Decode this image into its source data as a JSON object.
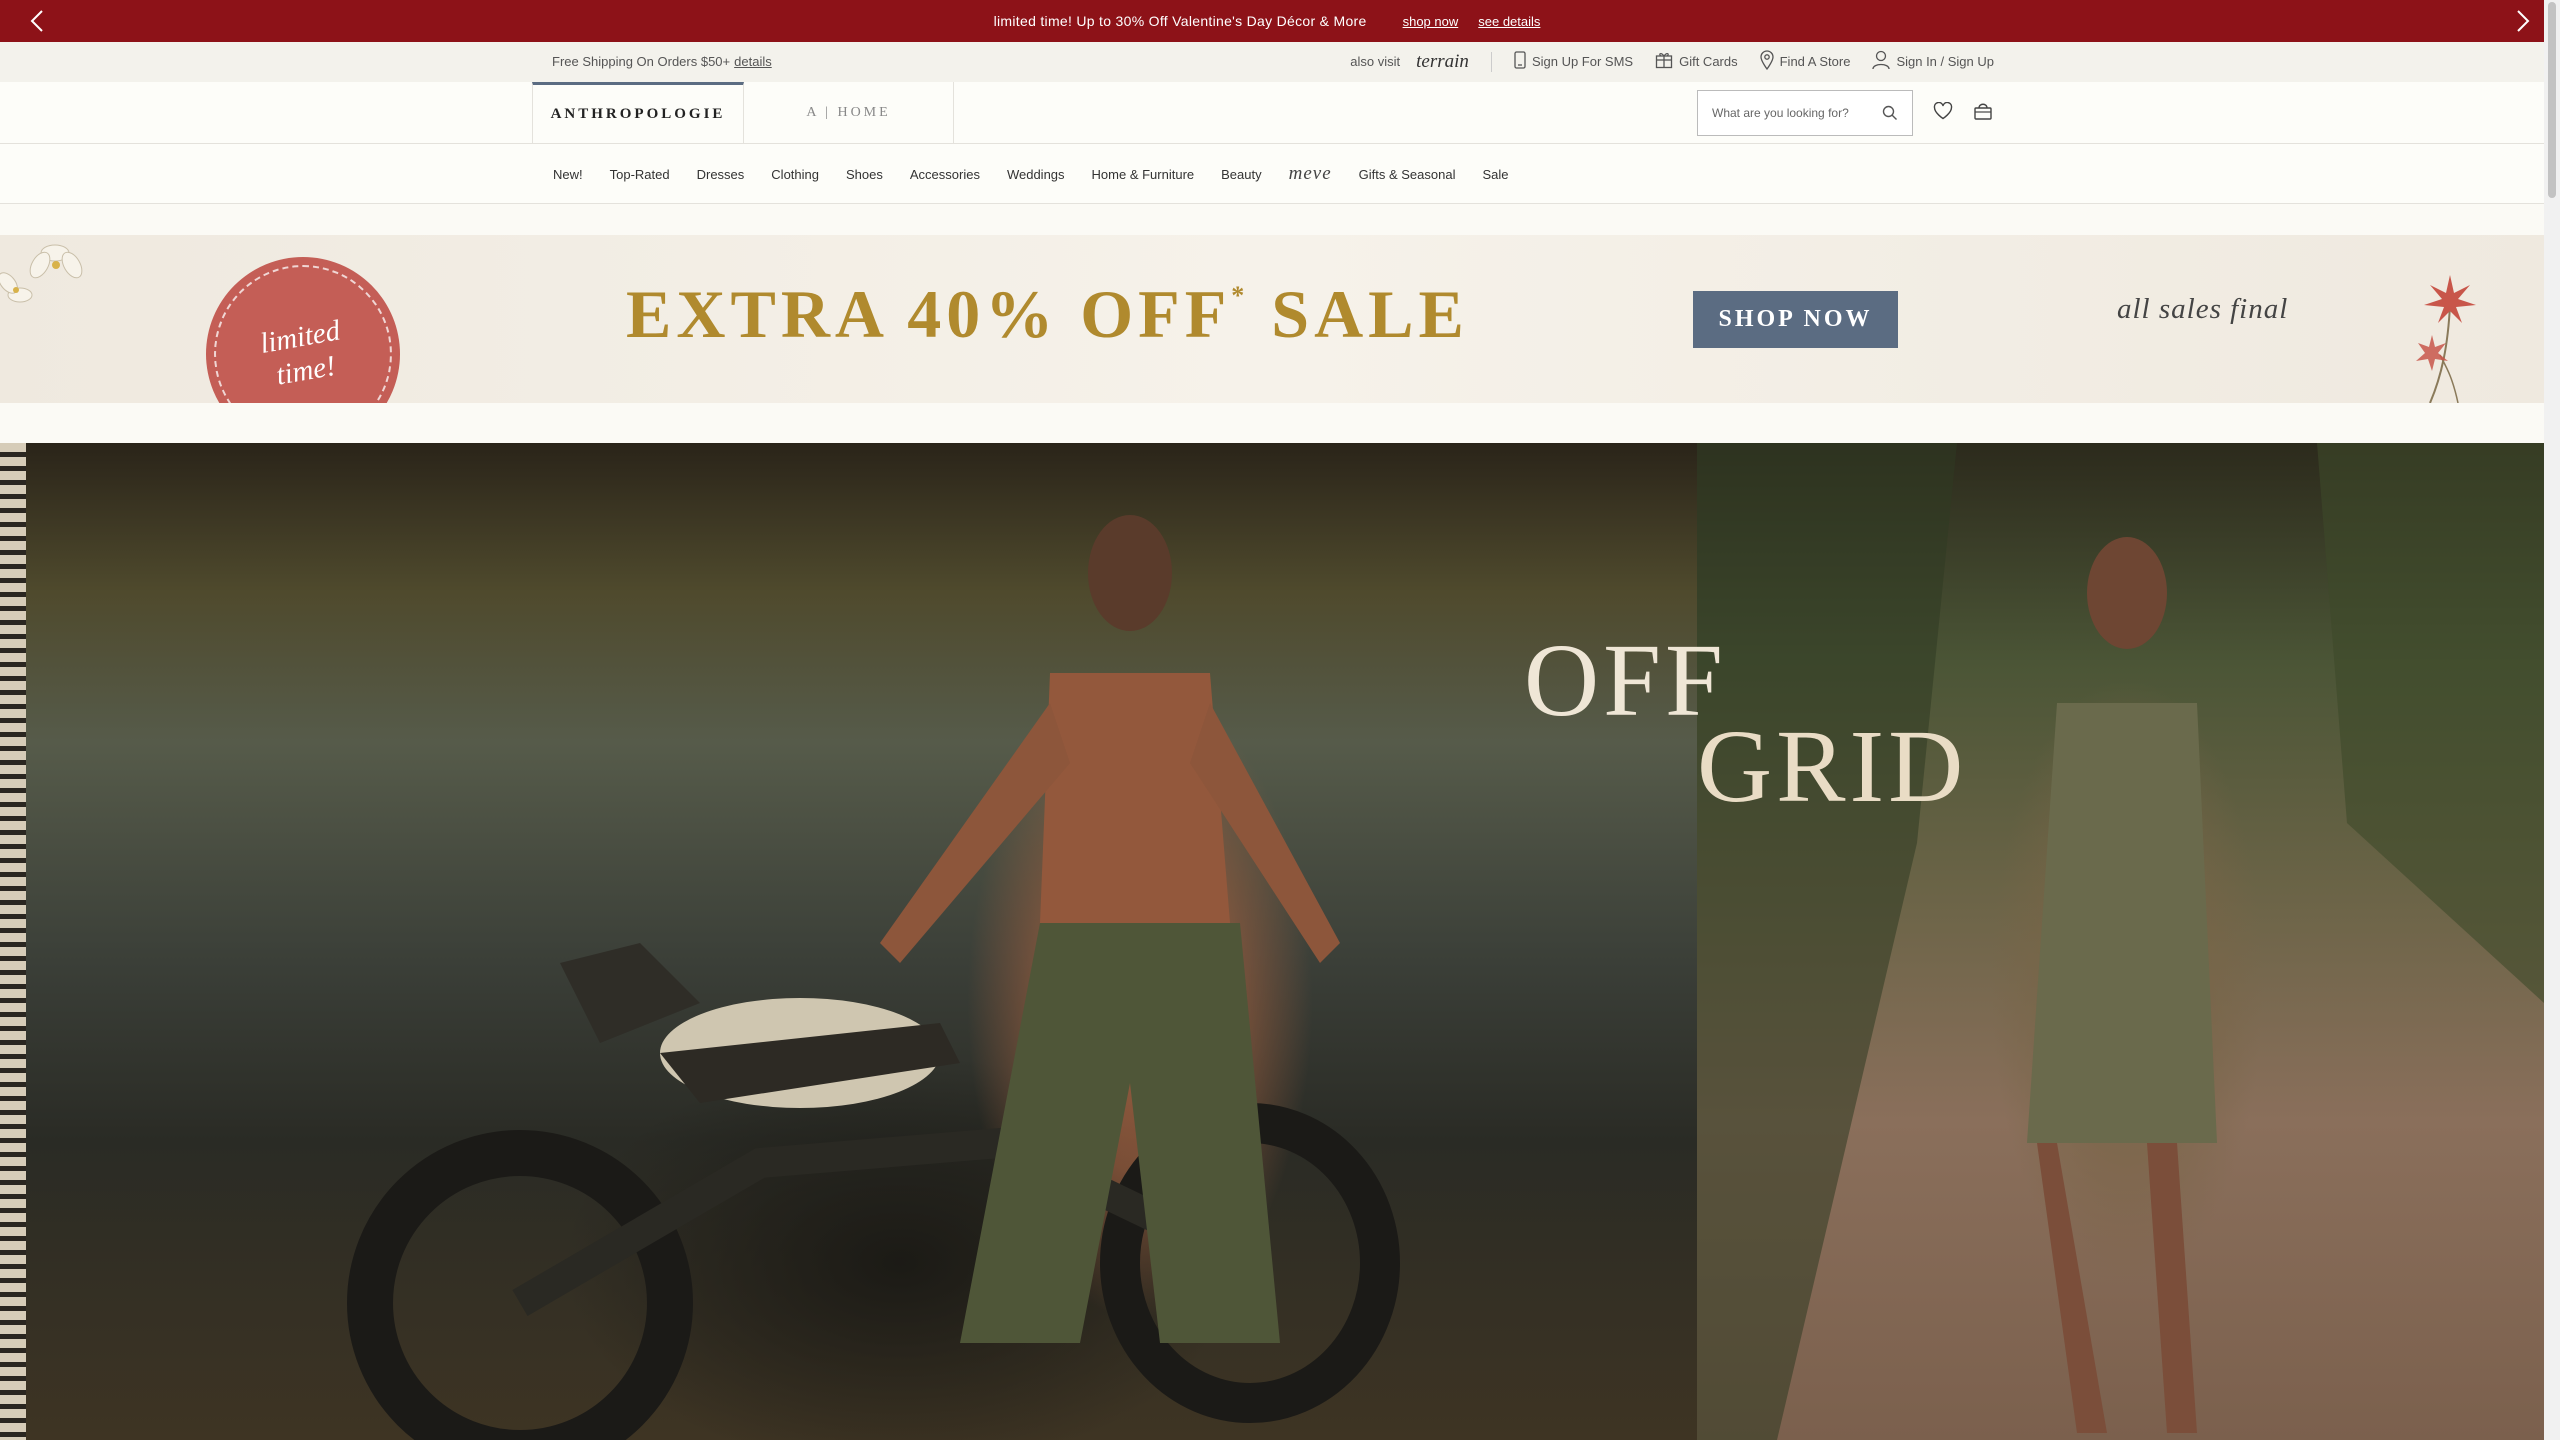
{
  "promo": {
    "message": "limited time! Up to 30% Off Valentine's Day Décor & More",
    "shop_now": "shop now",
    "see_details": "see details",
    "background": "#8d1218"
  },
  "utility": {
    "shipping": "Free Shipping On Orders $50+",
    "details": "details",
    "also_visit": "also visit",
    "terrain": "terrain",
    "sms": "Sign Up For SMS",
    "gift_cards": "Gift Cards",
    "find_store": "Find A Store",
    "sign_in": "Sign In / Sign Up"
  },
  "header": {
    "brand": "ANTHROPOLOGIE",
    "home_brand": "A | HOME",
    "search_placeholder": "What are you looking for?",
    "accent": "#5b6c82"
  },
  "nav": {
    "items": [
      "New!",
      "Top-Rated",
      "Dresses",
      "Clothing",
      "Shoes",
      "Accessories",
      "Weddings",
      "Home & Furniture",
      "Beauty",
      "meve",
      "Gifts & Seasonal",
      "Sale"
    ]
  },
  "sale_banner": {
    "badge": "limited time!",
    "headline": "EXTRA 40% OFF",
    "asterisk": "*",
    "headline_end": "SALE",
    "cta": "SHOP NOW",
    "note": "all sales final",
    "headline_color": "#b08a2e",
    "badge_color": "#c45e56"
  },
  "hero": {
    "word1": "OFF",
    "word2": "GRID"
  }
}
